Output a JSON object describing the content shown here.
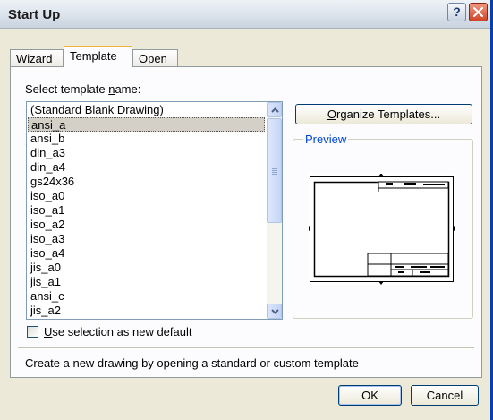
{
  "window": {
    "title": "Start Up",
    "help_label": "?"
  },
  "tabs": [
    {
      "label": "Wizard",
      "active": false
    },
    {
      "label": "Template",
      "active": true
    },
    {
      "label": "Open",
      "active": false
    }
  ],
  "template_list": {
    "label_before": "Select template ",
    "label_underlined": "n",
    "label_after": "ame:",
    "items": [
      "(Standard Blank Drawing)",
      "ansi_a",
      "ansi_b",
      "din_a3",
      "din_a4",
      "gs24x36",
      "iso_a0",
      "iso_a1",
      "iso_a2",
      "iso_a3",
      "iso_a4",
      "jis_a0",
      "jis_a1",
      "ansi_c",
      "jis_a2"
    ],
    "selected_index": 1
  },
  "organize_button": {
    "underlined": "O",
    "rest": "rganize Templates..."
  },
  "preview": {
    "label": "Preview"
  },
  "default_checkbox": {
    "underlined": "U",
    "rest": "se selection as new default",
    "checked": false
  },
  "status_text": "Create a new drawing by opening a standard or custom template",
  "buttons": {
    "ok": "OK",
    "cancel": "Cancel"
  },
  "colors": {
    "title_bar": "#dfe6ee",
    "dialog_bg": "#ece9d8",
    "close_button": "#d04427",
    "active_tab_highlight": "#f0b23a",
    "group_title": "#0046d5",
    "selection_bg": "#d4d0c8"
  }
}
